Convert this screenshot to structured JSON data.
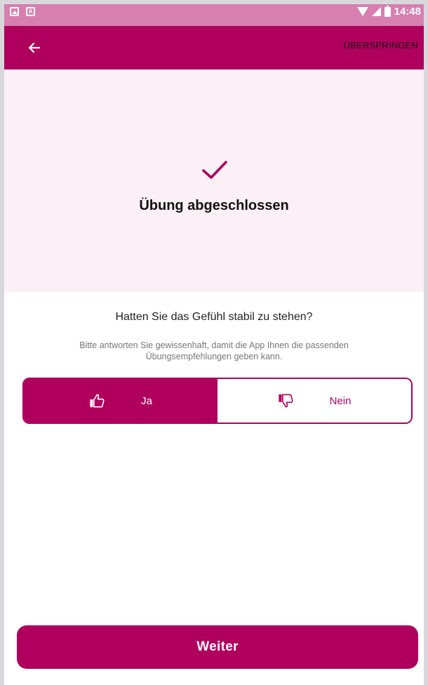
{
  "status_bar": {
    "left_icons": [
      "image-notification-icon",
      "text-a-notification-icon"
    ],
    "a_label": "A",
    "time": "14:48",
    "icons": [
      "wifi-icon",
      "signal-icon",
      "battery-icon"
    ]
  },
  "app_bar": {
    "back_icon": "arrow-left-icon",
    "skip_label": "ÜBERSPRINGEN"
  },
  "hero": {
    "icon": "checkmark-icon",
    "title": "Übung abgeschlossen"
  },
  "question": {
    "text": "Hatten Sie das Gefühl stabil zu stehen?",
    "hint": "Bitte antworten Sie gewissenhaft, damit die App Ihnen die passenden Übungsempfehlungen geben kann."
  },
  "options": {
    "yes_label": "Ja",
    "yes_icon": "thumbs-up-icon",
    "no_label": "Nein",
    "no_icon": "thumbs-down-icon",
    "selected": "yes"
  },
  "footer": {
    "continue_label": "Weiter"
  },
  "colors": {
    "primary": "#b0005e",
    "status_bar": "#d67fb0",
    "hero_background": "#fbf0f5",
    "hint_text": "#777777"
  }
}
